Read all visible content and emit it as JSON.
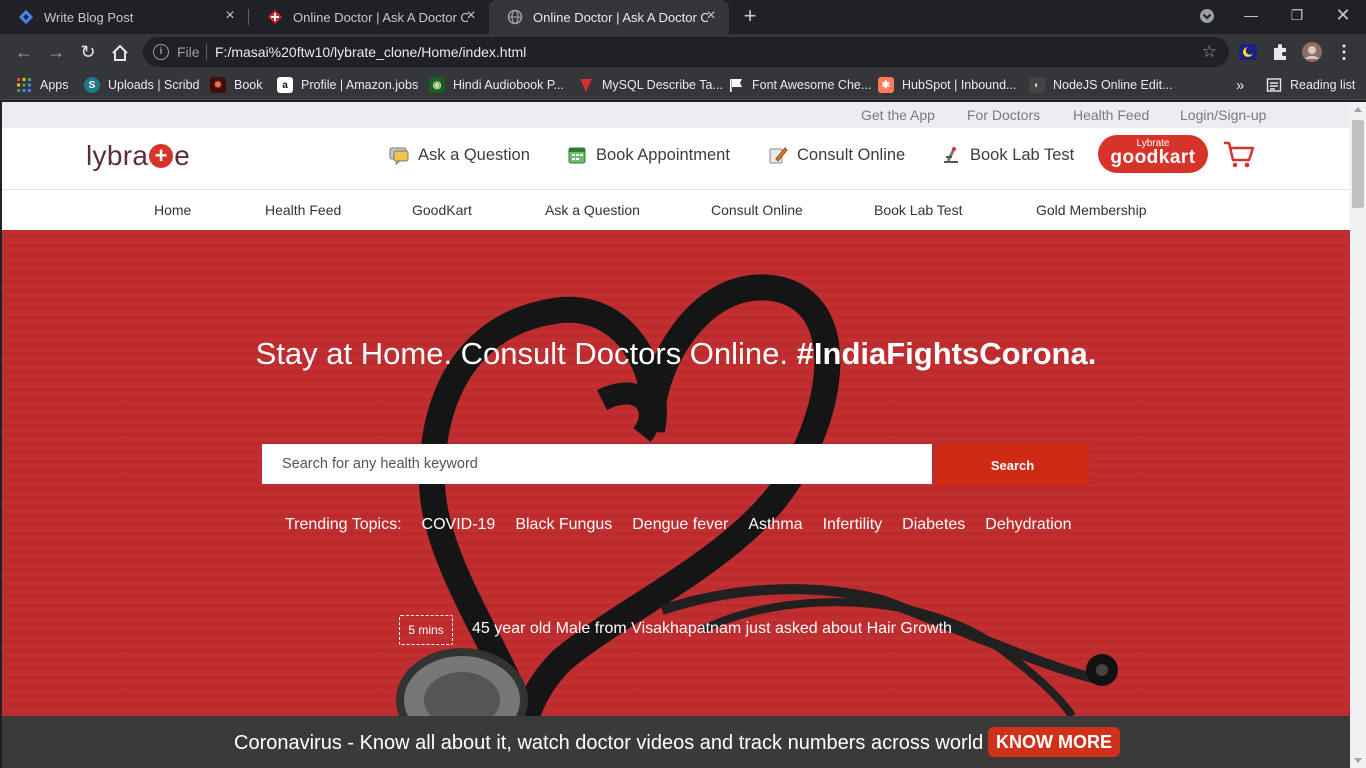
{
  "browser": {
    "tabs": [
      {
        "title": "Write Blog Post",
        "icon": "blog-icon",
        "active": false
      },
      {
        "title": "Online Doctor | Ask A Doctor Online",
        "icon": "lybrate-icon",
        "active": false
      },
      {
        "title": "Online Doctor | Ask A Doctor Online",
        "icon": "globe-icon",
        "active": true
      }
    ],
    "address": {
      "scheme_label": "File",
      "url": "F:/masai%20ftw10/lybrate_clone/Home/index.html"
    },
    "bookmarks": [
      {
        "label": "Apps",
        "icon": "apps-grid-icon",
        "color": "#f4b400"
      },
      {
        "label": "Uploads | Scribd",
        "icon": "scribd-icon",
        "color": "#1e7b85"
      },
      {
        "label": "Book",
        "icon": "book-icon",
        "color": "#8b1a1a"
      },
      {
        "label": "Profile | Amazon.jobs",
        "icon": "amazon-icon",
        "color": "#ffffff"
      },
      {
        "label": "Hindi Audiobook P...",
        "icon": "audiobook-icon",
        "color": "#2e7d32"
      },
      {
        "label": "MySQL Describe Ta...",
        "icon": "mysql-icon",
        "color": "#d32f2f"
      },
      {
        "label": "Font Awesome Che...",
        "icon": "flag-icon",
        "color": "#ffffff"
      },
      {
        "label": "HubSpot | Inbound...",
        "icon": "hubspot-icon",
        "color": "#ff7a59"
      },
      {
        "label": "NodeJS Online Edit...",
        "icon": "node-icon",
        "color": "#cccccc"
      }
    ],
    "overflow_label": "»",
    "reading_list": "Reading list"
  },
  "site": {
    "toplinks": [
      "Get the App",
      "For Doctors",
      "Health Feed",
      "Login/Sign-up"
    ],
    "logo": {
      "left": "lybra",
      "right": "e"
    },
    "header_nav": [
      {
        "label": "Ask a Question",
        "icon": "chat-question-icon"
      },
      {
        "label": "Book Appointment",
        "icon": "calendar-icon"
      },
      {
        "label": "Consult Online",
        "icon": "consult-pen-icon"
      },
      {
        "label": "Book Lab Test",
        "icon": "microscope-icon"
      }
    ],
    "goodkart": {
      "small": "Lybrate",
      "big": "goodkart"
    },
    "main_nav": [
      "Home",
      "Health Feed",
      "GoodKart",
      "Ask a Question",
      "Consult Online",
      "Book Lab Test",
      "Gold Membership"
    ],
    "hero": {
      "title_plain": "Stay at Home. Consult Doctors Online. ",
      "title_bold": "#IndiaFightsCorona.",
      "search_placeholder": "Search for any health keyword",
      "search_button": "Search",
      "trending_label": "Trending Topics:",
      "trending": [
        "COVID-19",
        "Black Fungus",
        "Dengue fever",
        "Asthma",
        "Infertility",
        "Diabetes",
        "Dehydration"
      ],
      "ticker_badge": "5 mins",
      "ticker_text": "45 year old Male from Visakhapatnam just asked about Hair Growth"
    },
    "banner": {
      "text": "Coronavirus - Know all about it, watch doctor videos and track numbers across world",
      "button": "KNOW MORE"
    },
    "colors": {
      "brand_red": "#d8332a",
      "hero_red": "#bf2c2e",
      "banner_bg": "#3a3a3a"
    }
  }
}
